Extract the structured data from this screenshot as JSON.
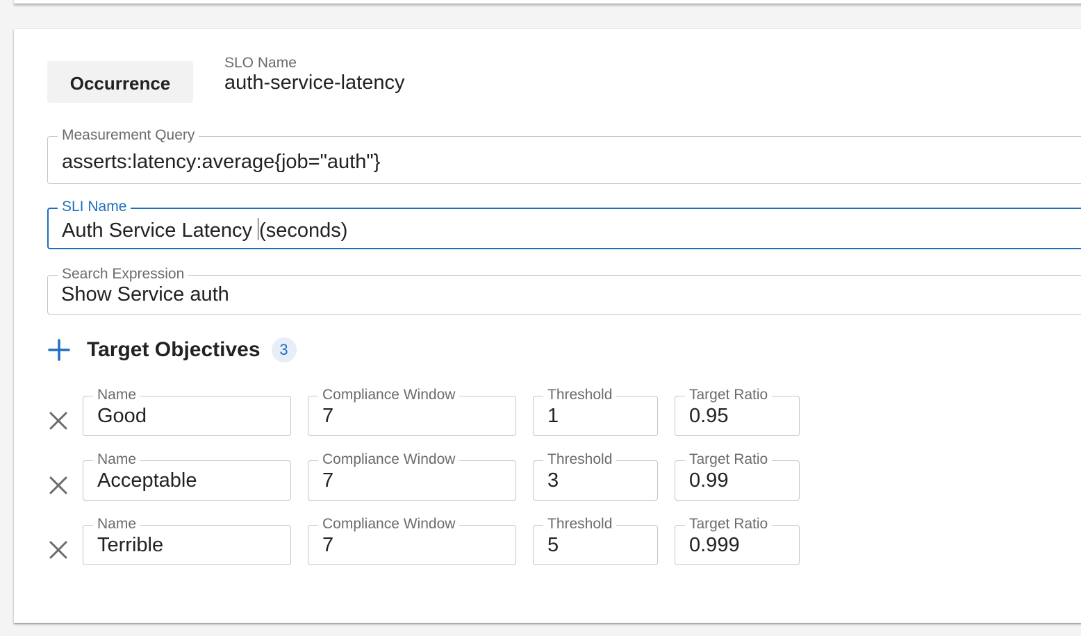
{
  "slo": {
    "type_chip": "Occurrence",
    "name_label": "SLO Name",
    "name_value": "auth-service-latency"
  },
  "fields": {
    "measurement_query": {
      "label": "Measurement Query",
      "value": "asserts:latency:average{job=\"auth\"}"
    },
    "sli_name": {
      "label": "SLI Name",
      "value_before_caret": "Auth Service Latency",
      "value_after_caret": "(seconds)"
    },
    "search_expression": {
      "label": "Search Expression",
      "value": "Show Service auth"
    }
  },
  "objectives": {
    "title": "Target Objectives",
    "count": "3",
    "column_labels": {
      "name": "Name",
      "window": "Compliance Window",
      "threshold": "Threshold",
      "ratio": "Target Ratio"
    },
    "rows": [
      {
        "name": "Good",
        "window": "7",
        "threshold": "1",
        "ratio": "0.95"
      },
      {
        "name": "Acceptable",
        "window": "7",
        "threshold": "3",
        "ratio": "0.99"
      },
      {
        "name": "Terrible",
        "window": "7",
        "threshold": "5",
        "ratio": "0.999"
      }
    ]
  },
  "icons": {
    "add": "plus-icon",
    "remove": "close-icon"
  },
  "colors": {
    "accent": "#1f6fbf",
    "text": "#222222",
    "muted": "#6b6b6b",
    "border": "#c4c4c4"
  }
}
